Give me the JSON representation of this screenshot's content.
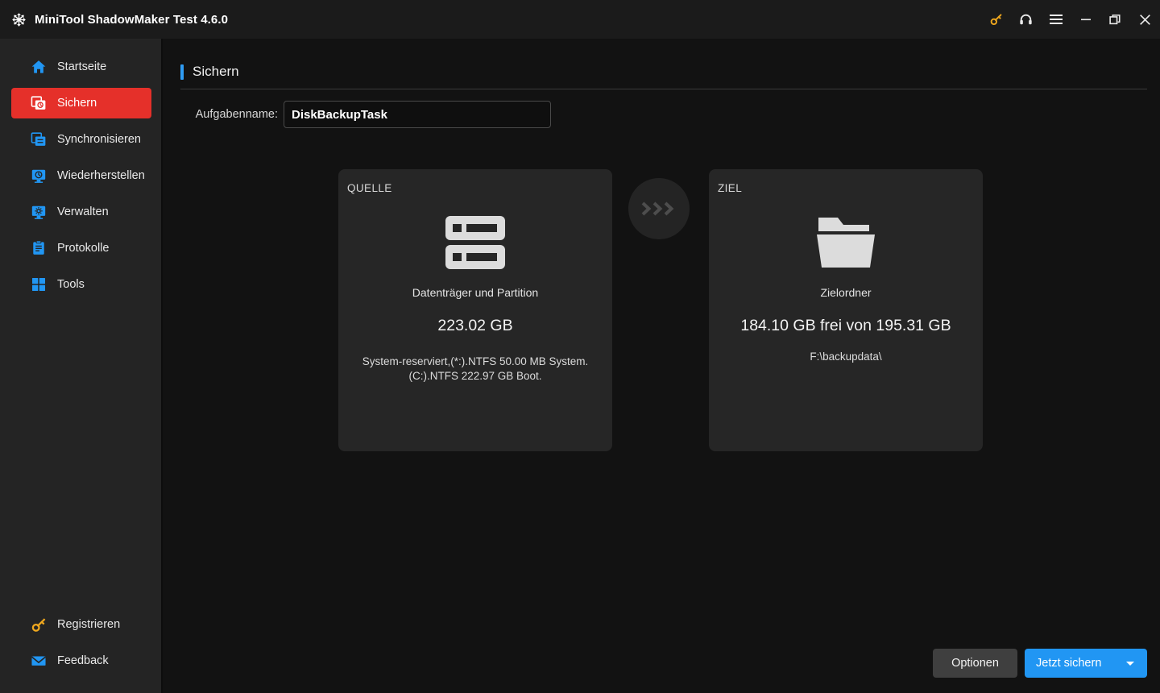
{
  "window": {
    "title": "MiniTool ShadowMaker Test 4.6.0",
    "logo_icon": "shadowmaker-logo-icon",
    "controls": [
      {
        "name": "key-icon",
        "label": "Register",
        "color": "#f0a81e"
      },
      {
        "name": "headset-icon",
        "label": "Support",
        "color": "#e9e9e9"
      },
      {
        "name": "menu-icon",
        "label": "Menu",
        "color": "#e9e9e9"
      },
      {
        "name": "minimize-icon",
        "label": "Minimize",
        "color": "#e9e9e9"
      },
      {
        "name": "restore-icon",
        "label": "Restore",
        "color": "#e9e9e9"
      },
      {
        "name": "close-icon",
        "label": "Close",
        "color": "#e9e9e9"
      }
    ]
  },
  "sidebar": {
    "items": [
      {
        "label": "Startseite",
        "icon": "home-icon",
        "active": false
      },
      {
        "label": "Sichern",
        "icon": "backup-icon",
        "active": true
      },
      {
        "label": "Synchronisieren",
        "icon": "sync-icon",
        "active": false
      },
      {
        "label": "Wiederherstellen",
        "icon": "restore-disk-icon",
        "active": false
      },
      {
        "label": "Verwalten",
        "icon": "manage-icon",
        "active": false
      },
      {
        "label": "Protokolle",
        "icon": "logs-icon",
        "active": false
      },
      {
        "label": "Tools",
        "icon": "tools-icon",
        "active": false
      }
    ],
    "bottom_items": [
      {
        "label": "Registrieren",
        "icon": "key-icon"
      },
      {
        "label": "Feedback",
        "icon": "mail-icon"
      }
    ],
    "active_color": "#e5302a",
    "icon_color": "#2196f3",
    "key_color": "#f0a81e"
  },
  "page": {
    "title": "Sichern",
    "accent_color": "#2f9cf4",
    "task_name_label": "Aufgabenname:",
    "task_name_value": "DiskBackupTask",
    "task_name_placeholder": "Aufgabenname"
  },
  "source_card": {
    "kicker": "QUELLE",
    "icon": "disk-partition-icon",
    "type": "Datenträger und Partition",
    "size": "223.02 GB",
    "detail": "System-reserviert,(*:).NTFS 50.00 MB System. (C:).NTFS 222.97 GB Boot."
  },
  "transfer_arrow": {
    "icon": "chevrons-right-icon"
  },
  "dest_card": {
    "kicker": "ZIEL",
    "icon": "folder-icon",
    "type": "Zielordner",
    "size": "184.10 GB frei von 195.31 GB",
    "detail": "F:\\backupdata\\"
  },
  "footer": {
    "options_label": "Optionen",
    "backup_label": "Jetzt sichern",
    "backup_color": "#2196f3",
    "dropdown_icon": "caret-down-icon"
  }
}
